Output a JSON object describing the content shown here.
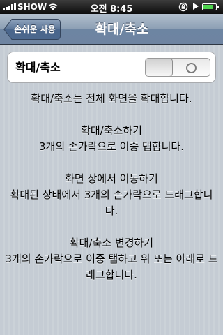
{
  "status_bar": {
    "carrier": "SHOW",
    "time": "오전 8:45",
    "battery_level": 0.85,
    "icons": [
      "signal-bars-icon",
      "wifi-icon",
      "rotation-lock-icon",
      "play-icon",
      "battery-icon"
    ]
  },
  "nav": {
    "back_label": "손쉬운 사용",
    "title": "확대/축소"
  },
  "setting": {
    "label": "확대/축소",
    "toggle_on": false
  },
  "description": {
    "intro": "확대/축소는 전체 화면을 확대합니다.",
    "zoom_title": "확대/축소하기",
    "zoom_text": "3개의 손가락으로 이중 탭합니다.",
    "move_title": "화면 상에서 이동하기",
    "move_text": "확대된 상태에서 3개의 손가락으로 드래그합니다.",
    "change_title": "확대/축소 변경하기",
    "change_text": "3개의 손가락으로 이중 탭하고 위 또는 아래로 드래그합니다."
  },
  "colors": {
    "background": "#c5ccd4",
    "nav_tint": "#6d85a2",
    "battery_fill": "#4ed44e"
  }
}
